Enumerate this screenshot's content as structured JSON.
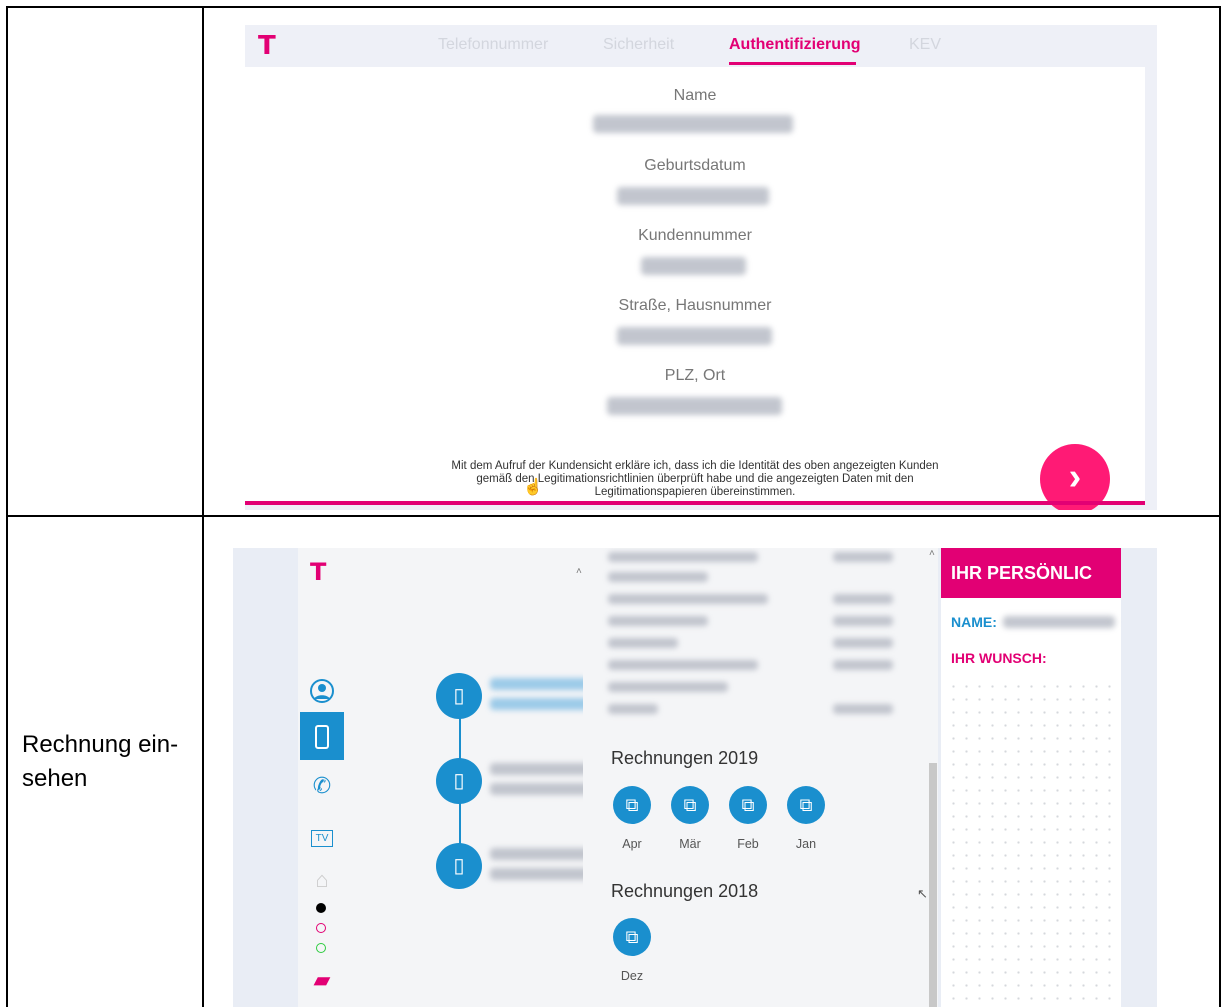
{
  "row2_label": "Rechnung ein-\nsehen",
  "screen1": {
    "tabs": [
      "Telefonnummer",
      "Sicherheit",
      "Authentifizierung",
      "KEV"
    ],
    "active_tab": "Authentifizierung",
    "fields": [
      "Name",
      "Geburtsdatum",
      "Kundennummer",
      "Straße, Hausnummer",
      "PLZ, Ort"
    ],
    "disclaimer": "Mit dem Aufruf der Kundensicht erkläre ich, dass ich die Identität des oben angezeigten Kunden gemäß den Legitimationsrichtlinien überprüft habe und die angezeigten Daten mit den Legitimationspapieren übereinstimmen.",
    "next_label": "›",
    "brand_color": "#e20074"
  },
  "screen2": {
    "nav_icons": [
      "user-icon",
      "mobile-phone-icon",
      "phone-globe-icon",
      "tv-icon",
      "home-icon",
      "inbox-icon"
    ],
    "tv_label": "TV",
    "rechnungen_2019": {
      "title": "Rechnungen 2019",
      "months": [
        "Apr",
        "Mär",
        "Feb",
        "Jan"
      ]
    },
    "rechnungen_2018": {
      "title": "Rechnungen 2018",
      "months": [
        "Dez"
      ]
    },
    "right_header": "IHR PERSÖNLIC",
    "name_label": "NAME:",
    "wunsch_label": "IHR WUNSCH:",
    "accent_blue": "#1a8fce",
    "accent_pink": "#e20074"
  }
}
